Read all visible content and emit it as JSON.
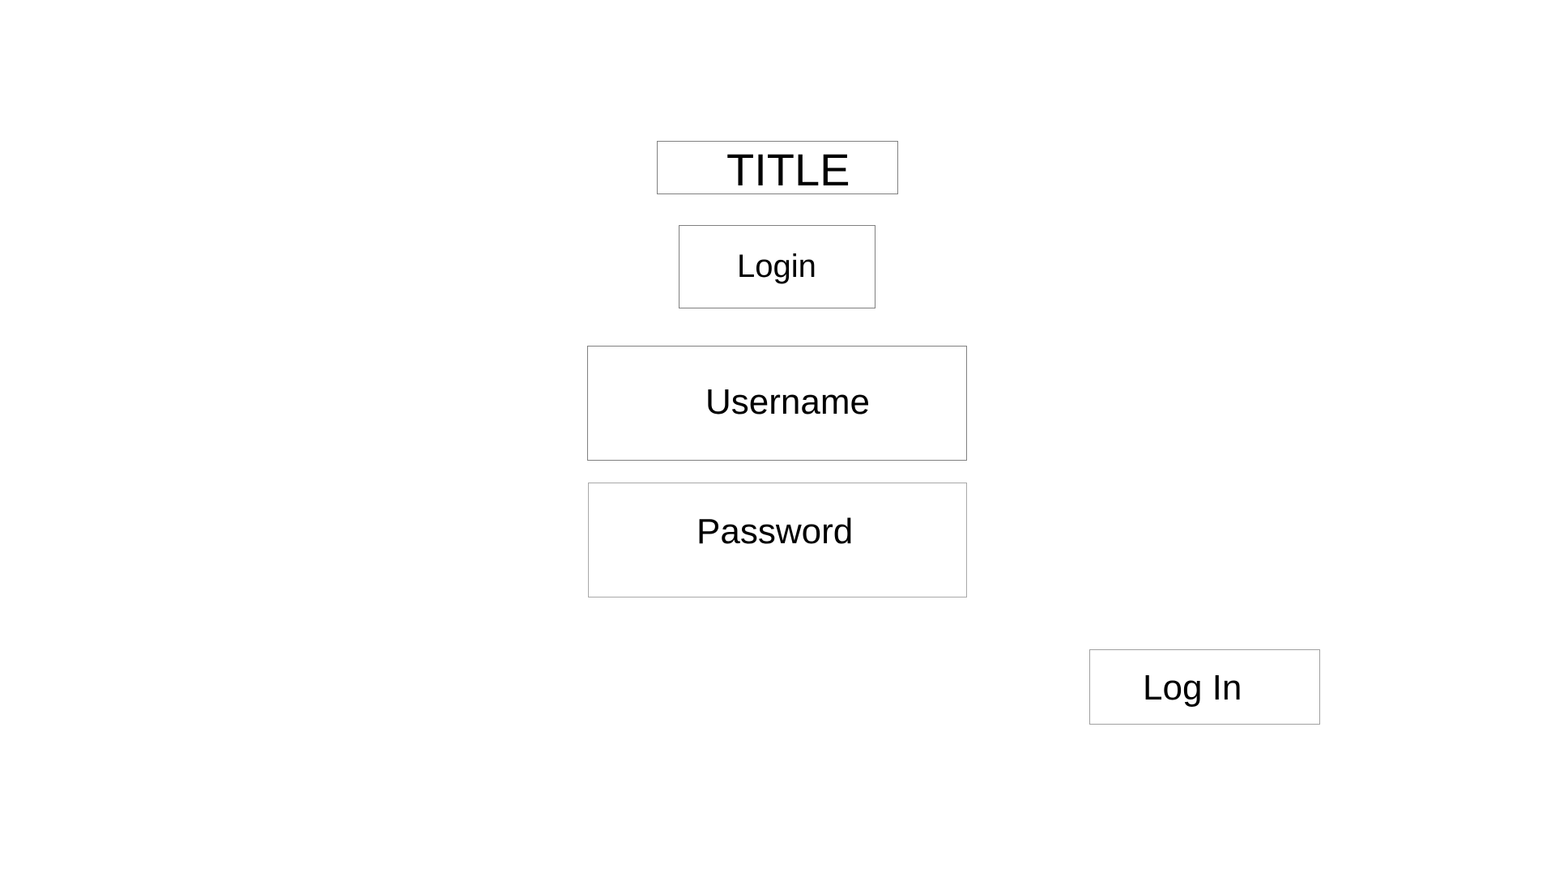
{
  "title": "TITLE",
  "heading": "Login",
  "username": {
    "placeholder": "Username"
  },
  "password": {
    "placeholder": "Password"
  },
  "login_button": "Log In"
}
